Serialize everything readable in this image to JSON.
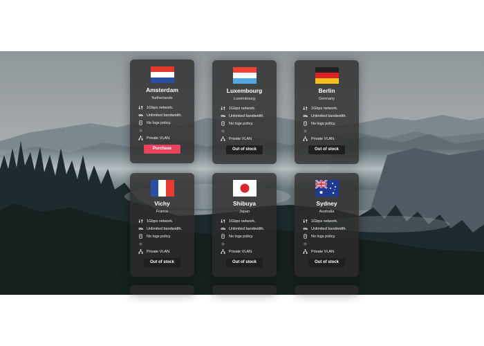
{
  "servers": [
    {
      "city": "Amsterdam",
      "country": "Netherlands",
      "flag": "netherlands-flag-icon",
      "button": "Purchase",
      "available": true
    },
    {
      "city": "Luxembourg",
      "country": "Luxembourg",
      "flag": "luxembourg-flag-icon",
      "button": "Out of stock",
      "available": false
    },
    {
      "city": "Berlin",
      "country": "Germany",
      "flag": "germany-flag-icon",
      "button": "Out of stock",
      "available": false
    },
    {
      "city": "Vichy",
      "country": "France",
      "flag": "france-flag-icon",
      "button": "Out of stock",
      "available": false
    },
    {
      "city": "Shibuya",
      "country": "Japan",
      "flag": "japan-flag-icon",
      "button": "Out of stock",
      "available": false
    },
    {
      "city": "Sydney",
      "country": "Australia",
      "flag": "australia-flag-icon",
      "button": "Out of stock",
      "available": false
    }
  ],
  "features": [
    {
      "label": "1Gbps network.",
      "icon": "network-icon"
    },
    {
      "label": "Unlimited bandwidth.",
      "icon": "infinity-icon"
    },
    {
      "label": "No logs policy.",
      "icon": "no-logs-icon"
    },
    {
      "label": "",
      "icon": "faded-icon"
    },
    {
      "label": "Private VLAN.",
      "icon": "vlan-icon"
    }
  ],
  "colors": {
    "card_background": "#2c2c2c",
    "purchase_button": "#e9445c",
    "out_of_stock_button": "#1f1f1f",
    "text": "#ffffff"
  }
}
